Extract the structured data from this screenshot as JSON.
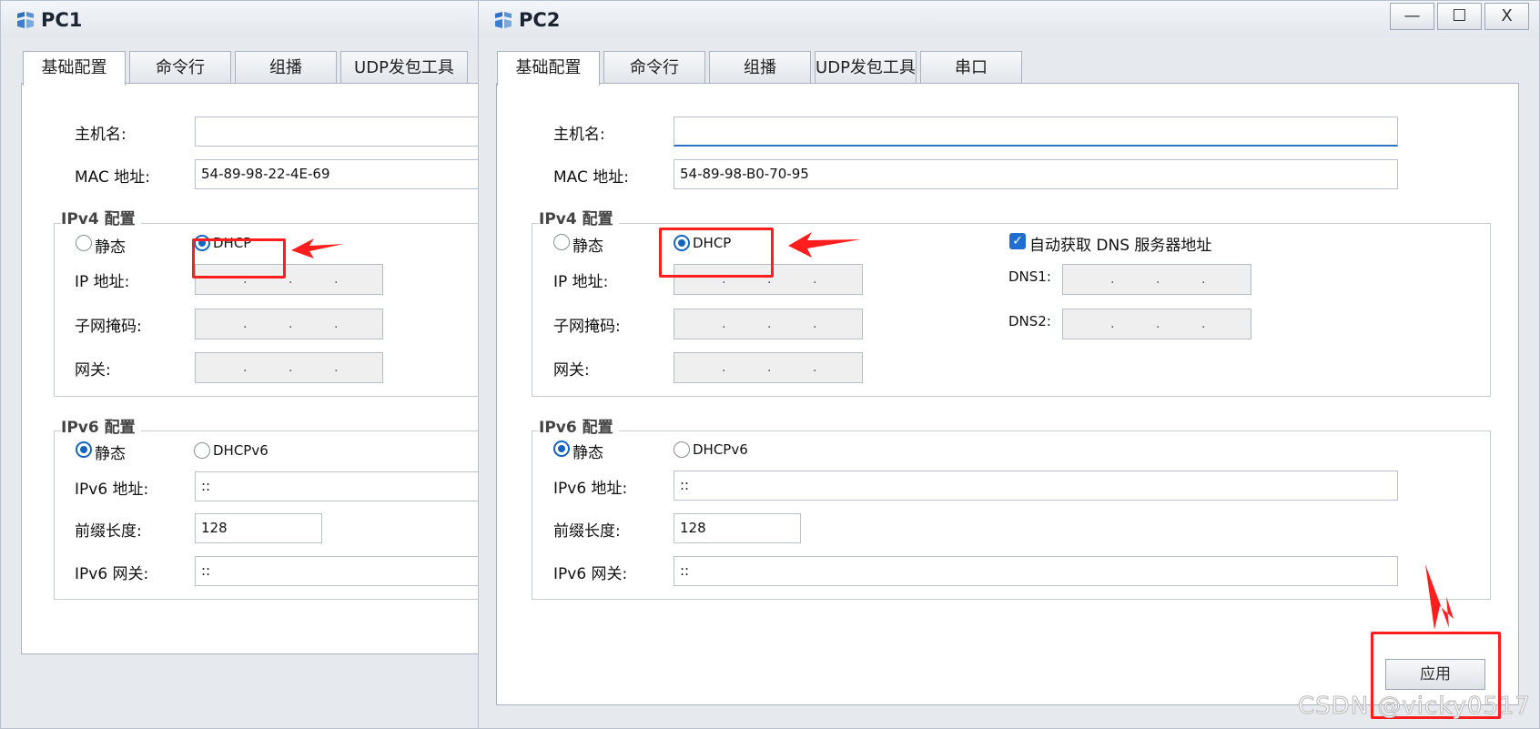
{
  "pc1": {
    "title": "PC1",
    "tabs": [
      "基础配置",
      "命令行",
      "组播",
      "UDP发包工具"
    ],
    "hostname_label": "主机名:",
    "hostname_value": "",
    "mac_label": "MAC 地址:",
    "mac_value": "54-89-98-22-4E-69",
    "ipv4_group": "IPv4 配置",
    "static_label": "静态",
    "dhcp_label": "DHCP",
    "ip_label": "IP 地址:",
    "mask_label": "子网掩码:",
    "gateway_label": "网关:",
    "ipv6_group": "IPv6 配置",
    "ipv6_static_label": "静态",
    "dhcpv6_label": "DHCPv6",
    "ipv6_addr_label": "IPv6 地址:",
    "ipv6_addr_value": "::",
    "prefix_label": "前缀长度:",
    "prefix_value": "128",
    "ipv6_gw_label": "IPv6 网关:",
    "ipv6_gw_value": "::"
  },
  "pc2": {
    "title": "PC2",
    "window_controls": {
      "minimize": "—",
      "maximize": "☐",
      "close": "X"
    },
    "tabs": [
      "基础配置",
      "命令行",
      "组播",
      "UDP发包工具",
      "串口"
    ],
    "hostname_label": "主机名:",
    "hostname_value": "",
    "mac_label": "MAC 地址:",
    "mac_value": "54-89-98-B0-70-95",
    "ipv4_group": "IPv4 配置",
    "static_label": "静态",
    "dhcp_label": "DHCP",
    "auto_dns_label": "自动获取 DNS 服务器地址",
    "ip_label": "IP 地址:",
    "mask_label": "子网掩码:",
    "gateway_label": "网关:",
    "dns1_label": "DNS1:",
    "dns2_label": "DNS2:",
    "ipv6_group": "IPv6 配置",
    "ipv6_static_label": "静态",
    "dhcpv6_label": "DHCPv6",
    "ipv6_addr_label": "IPv6 地址:",
    "ipv6_addr_value": "::",
    "prefix_label": "前缀长度:",
    "prefix_value": "128",
    "ipv6_gw_label": "IPv6 网关:",
    "ipv6_gw_value": "::",
    "apply_label": "应用"
  },
  "watermark": "CSDN @vicky0517",
  "colors": {
    "annotation": "#ff1e1e",
    "accent": "#1565c0"
  }
}
